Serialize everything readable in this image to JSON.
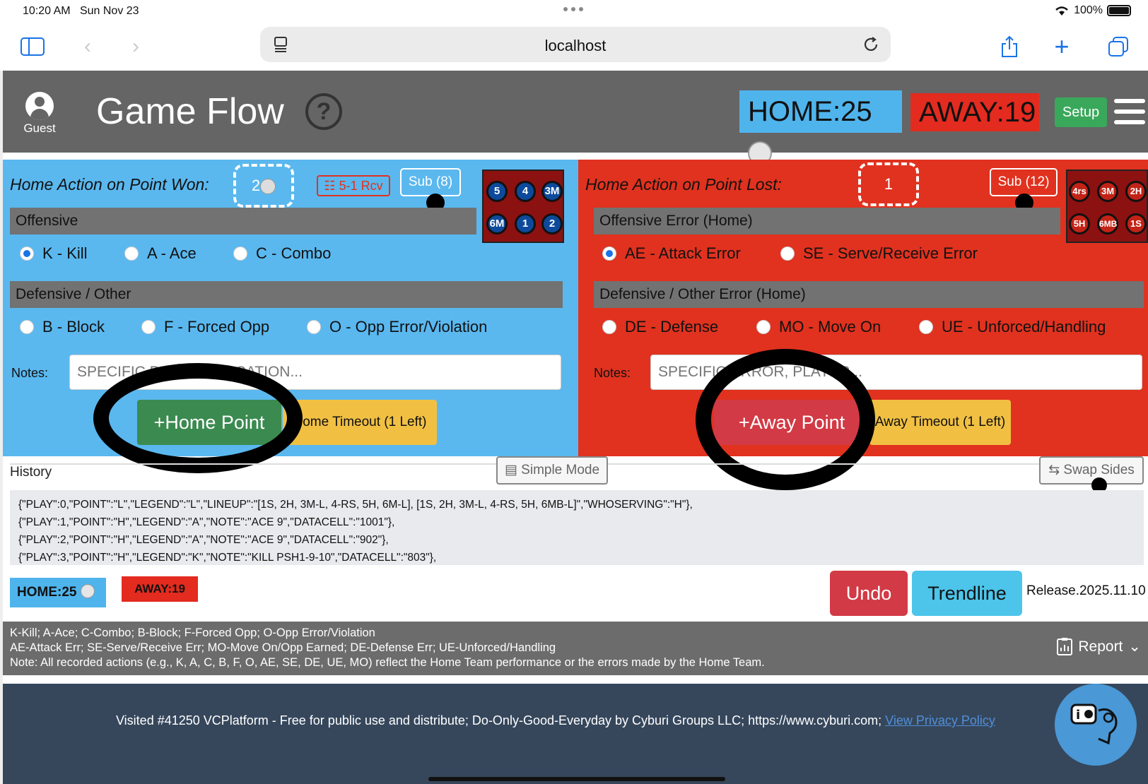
{
  "status": {
    "time": "10:20 AM",
    "date": "Sun Nov 23",
    "battery": "100%"
  },
  "browser": {
    "url": "localhost"
  },
  "header": {
    "user": "Guest",
    "title": "Game Flow",
    "help": "?",
    "home_score": "HOME:25",
    "away_score": "AWAY:19",
    "setup": "Setup"
  },
  "home_panel": {
    "title": "Home Action on Point Won:",
    "rotation": "2",
    "rcv": "5-1 Rcv",
    "sub": "Sub (8)",
    "court_front": [
      "5",
      "4",
      "3M"
    ],
    "court_back": [
      "6M",
      "1",
      "2"
    ],
    "offensive": "Offensive",
    "offensive_options": [
      "K - Kill",
      "A - Ace",
      "C - Combo"
    ],
    "defensive": "Defensive / Other",
    "defensive_options": [
      "B - Block",
      "F - Forced Opp",
      "O - Opp Error/Violation"
    ],
    "notes_label": "Notes:",
    "notes_placeholder": "SPECIFIC PLAYER, LOCATION...",
    "point_btn": "+Home Point",
    "timeout_btn": "Home Timeout (1 Left)"
  },
  "away_panel": {
    "title": "Home Action on Point Lost:",
    "rotation": "1",
    "sub": "Sub (12)",
    "court_front": [
      "4rs",
      "3M",
      "2H"
    ],
    "court_back": [
      "5H",
      "6MB",
      "1S"
    ],
    "offensive": "Offensive Error (Home)",
    "offensive_options": [
      "AE - Attack Error",
      "SE - Serve/Receive Error"
    ],
    "defensive": "Defensive / Other Error (Home)",
    "defensive_options": [
      "DE - Defense",
      "MO - Move On",
      "UE - Unforced/Handling"
    ],
    "notes_label": "Notes:",
    "notes_placeholder": "SPECIFIC ERROR, PLAYER...",
    "point_btn": "+Away Point",
    "timeout_btn": "Away Timeout (1 Left)"
  },
  "history": {
    "label": "History",
    "simple_mode": "Simple Mode",
    "swap_sides": "Swap Sides",
    "lines": [
      "{\"PLAY\":0,\"POINT\":\"L\",\"LEGEND\":\"L\",\"LINEUP\":\"[1S, 2H, 3M-L, 4-RS, 5H, 6M-L], [1S, 2H, 3M-L, 4-RS, 5H, 6MB-L]\",\"WHOSERVING\":\"H\"},",
      "{\"PLAY\":1,\"POINT\":\"H\",\"LEGEND\":\"A\",\"NOTE\":\"ACE 9\",\"DATACELL\":\"1001\"},",
      "{\"PLAY\":2,\"POINT\":\"H\",\"LEGEND\":\"A\",\"NOTE\":\"ACE 9\",\"DATACELL\":\"902\"},",
      "{\"PLAY\":3,\"POINT\":\"H\",\"LEGEND\":\"K\",\"NOTE\":\"KILL PSH1-9-10\",\"DATACELL\":\"803\"},"
    ]
  },
  "bottom": {
    "home_score": "HOME:25",
    "away_score": "AWAY:19",
    "undo": "Undo",
    "trendline": "Trendline",
    "release": "Release.2025.11.10"
  },
  "legend": {
    "line1": "K-Kill; A-Ace; C-Combo; B-Block; F-Forced Opp; O-Opp Error/Violation",
    "line2": "AE-Attack Err; SE-Serve/Receive Err; MO-Move On/Opp Earned; DE-Defense Err; UE-Unforced/Handling",
    "line3": "Note: All recorded actions (e.g., K, A, C, B, F, O, AE, SE, DE, UE, MO) reflect the Home Team performance or the errors made by the Home Team.",
    "report": "Report"
  },
  "footer": {
    "text": "Visited #41250  VCPlatform - Free for public use and distribute; Do-Only-Good-Everyday by Cyburi Groups LLC; https://www.cyburi.com; ",
    "privacy": "View Privacy Policy"
  },
  "colors": {
    "home": "#5ab8ef",
    "away": "#e0321f",
    "header": "#656565",
    "footer": "#36475c"
  }
}
